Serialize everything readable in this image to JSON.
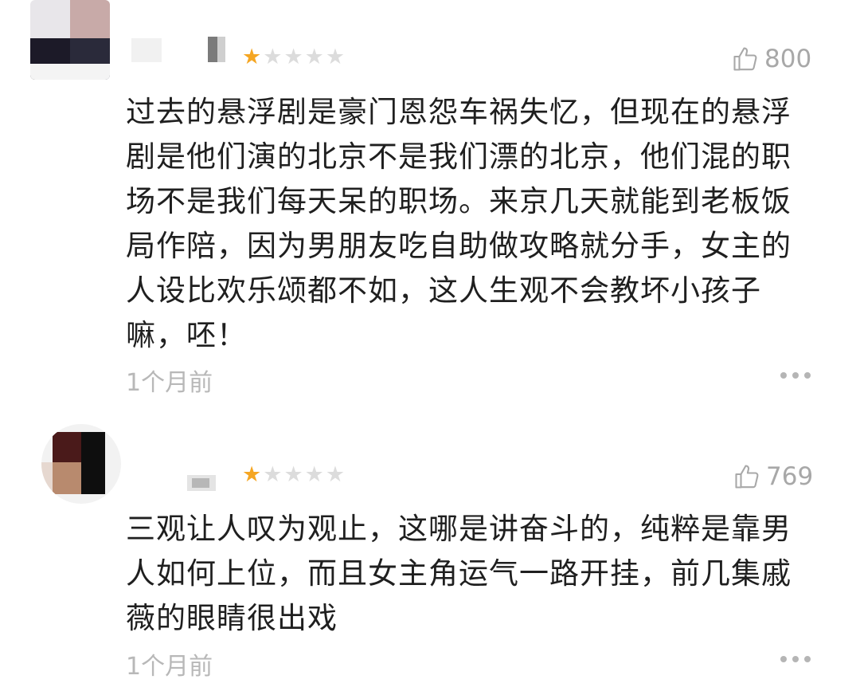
{
  "reviews": [
    {
      "rating": 1,
      "max_rating": 5,
      "likes": "800",
      "text": "过去的悬浮剧是豪门恩怨车祸失忆，但现在的悬浮剧是他们演的北京不是我们漂的北京，他们混的职场不是我们每天呆的职场。来京几天就能到老板饭局作陪，因为男朋友吃自助做攻略就分手，女主的人设比欢乐颂都不如，这人生观不会教坏小孩子嘛，呸！",
      "time": "1个月前"
    },
    {
      "rating": 1,
      "max_rating": 5,
      "likes": "769",
      "text": "三观让人叹为观止，这哪是讲奋斗的，纯粹是靠男人如何上位，而且女主角运气一路开挂，前几集戚薇的眼睛很出戏",
      "time": "1个月前"
    }
  ],
  "icons": {
    "like": "thumbs-up-outline-icon",
    "more": "more-dots-icon",
    "star": "star-icon"
  },
  "colors": {
    "star_active": "#f5a623",
    "star_inactive": "#dcdcdc",
    "meta": "#b8b8b8",
    "text": "#1f1f1f"
  }
}
